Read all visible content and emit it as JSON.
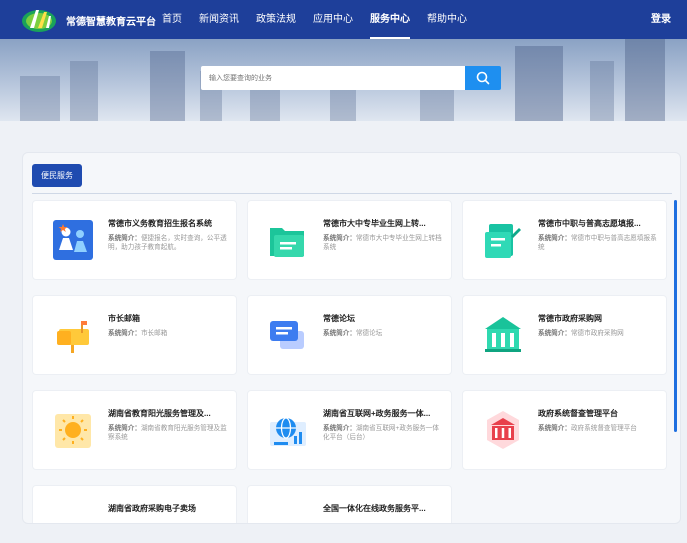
{
  "header": {
    "site_name": "常德智慧教育云平台",
    "menu": [
      {
        "label": "首页",
        "active": false
      },
      {
        "label": "新闻资讯",
        "active": false
      },
      {
        "label": "政策法规",
        "active": false
      },
      {
        "label": "应用中心",
        "active": false
      },
      {
        "label": "服务中心",
        "active": true
      },
      {
        "label": "帮助中心",
        "active": false
      }
    ],
    "login_label": "登录"
  },
  "search": {
    "placeholder": "输入您要查询的业务",
    "button_icon": "search-icon"
  },
  "section": {
    "tab_label": "便民服务"
  },
  "cards": [
    {
      "title": "常德市义务教育招生报名系统",
      "desc_label": "系统简介：",
      "desc": "便捷报名，实时查询，公平透明，助力孩子教育起航。",
      "icon": "family-icon"
    },
    {
      "title": "常德市大中专毕业生网上转...",
      "desc_label": "系统简介：",
      "desc": "常德市大中专毕业生网上转档系统",
      "icon": "folder-icon"
    },
    {
      "title": "常德市中职与普高志愿填报...",
      "desc_label": "系统简介：",
      "desc": "常德市中职与普高志愿填报系统",
      "icon": "form-icon"
    },
    {
      "title": "市长邮箱",
      "desc_label": "系统简介：",
      "desc": "市长邮箱",
      "icon": "mailbox-icon"
    },
    {
      "title": "常德论坛",
      "desc_label": "系统简介：",
      "desc": "常德论坛",
      "icon": "chat-icon"
    },
    {
      "title": "常德市政府采购网",
      "desc_label": "系统简介：",
      "desc": "常德市政府采购网",
      "icon": "government-building-icon"
    },
    {
      "title": "湖南省教育阳光服务管理及...",
      "desc_label": "系统简介：",
      "desc": "湖南省教育阳光服务管理及监察系统",
      "icon": "sun-icon"
    },
    {
      "title": "湖南省互联网+政务服务一体...",
      "desc_label": "系统简介：",
      "desc": "湖南省互联网+政务服务一体化平台（后台）",
      "icon": "globe-icon"
    },
    {
      "title": "政府系统督查管理平台",
      "desc_label": "系统简介：",
      "desc": "政府系统督查管理平台",
      "icon": "bank-icon"
    },
    {
      "title": "湖南省政府采购电子卖场",
      "desc_label": "",
      "desc": "",
      "icon": "store-icon"
    },
    {
      "title": "全国一体化在线政务服务平...",
      "desc_label": "",
      "desc": "",
      "icon": "service-icon"
    }
  ],
  "colors": {
    "nav_bg": "#1e3f9a",
    "accent": "#1f4bb0",
    "search_button": "#1e8ff0"
  }
}
